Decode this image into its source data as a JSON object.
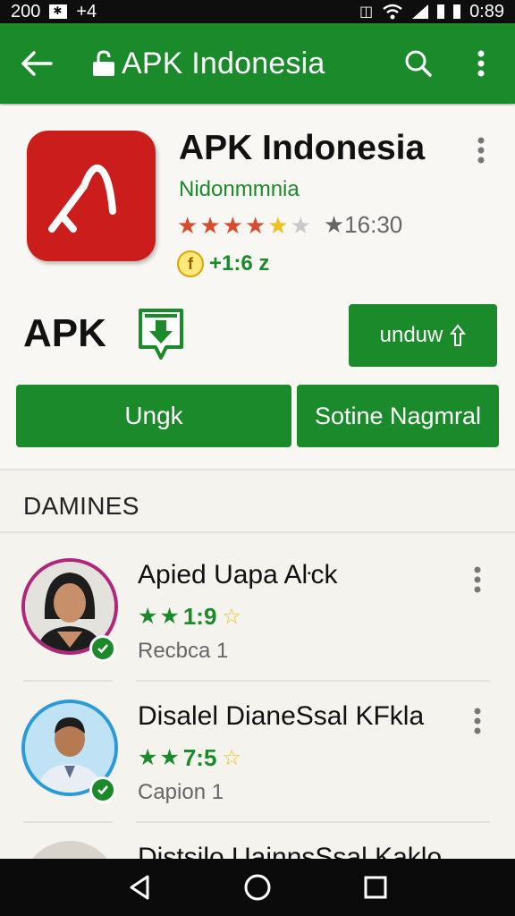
{
  "status_bar": {
    "left_text": "200",
    "left_extra": "+4",
    "time": "0:89"
  },
  "app_bar": {
    "title": "APK Indonesia"
  },
  "app": {
    "name": "APK Indonesia",
    "developer": "Nidonmmnia",
    "rating_text": "★16:30",
    "rating_stars": 4.5,
    "coin_symbol": "f",
    "coin_text": "+1:6 z",
    "apk_label": "APK",
    "unduh_label": "unduw",
    "btn_left_label": "Ungk",
    "btn_right_label": "Sotine Nagmral"
  },
  "colors": {
    "primary_green": "#1a8a2b",
    "icon_red": "#cc1d1d",
    "star_red": "#d94b2b",
    "star_yellow": "#f0c020"
  },
  "section": {
    "title": "DAMINES"
  },
  "list": [
    {
      "title": "Apied Uapa Aŀck",
      "rating": "1:9",
      "subtitle": "Recbca 1",
      "avatar_ring": "#b0267a"
    },
    {
      "title": "Disalel DianeSsal KFkla",
      "rating": "7:5",
      "subtitle": "Capion 1",
      "avatar_ring": "#2a9ad8"
    },
    {
      "title": "Distsilo UainnsSsal Kaklo",
      "rating": "",
      "subtitle": "",
      "avatar_ring": "#777"
    }
  ]
}
